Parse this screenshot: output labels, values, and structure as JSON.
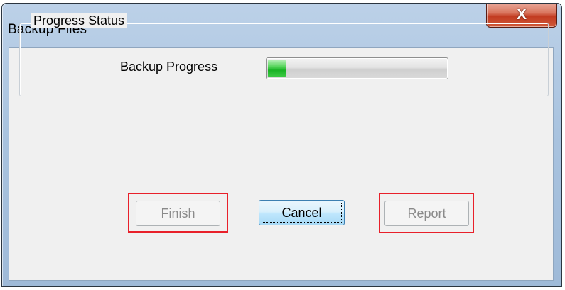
{
  "window": {
    "title": "Backup Files",
    "close_glyph": "X"
  },
  "group": {
    "legend": "Progress Status"
  },
  "progress": {
    "label": "Backup Progress",
    "value_fraction": 0.1,
    "fill_color": "#19b325"
  },
  "buttons": {
    "finish": {
      "label": "Finish",
      "enabled": false
    },
    "cancel": {
      "label": "Cancel",
      "enabled": true,
      "default": true
    },
    "report": {
      "label": "Report",
      "enabled": false
    }
  },
  "annotations": {
    "highlight_color": "#e8202a",
    "highlighted": [
      "finish",
      "report"
    ]
  }
}
